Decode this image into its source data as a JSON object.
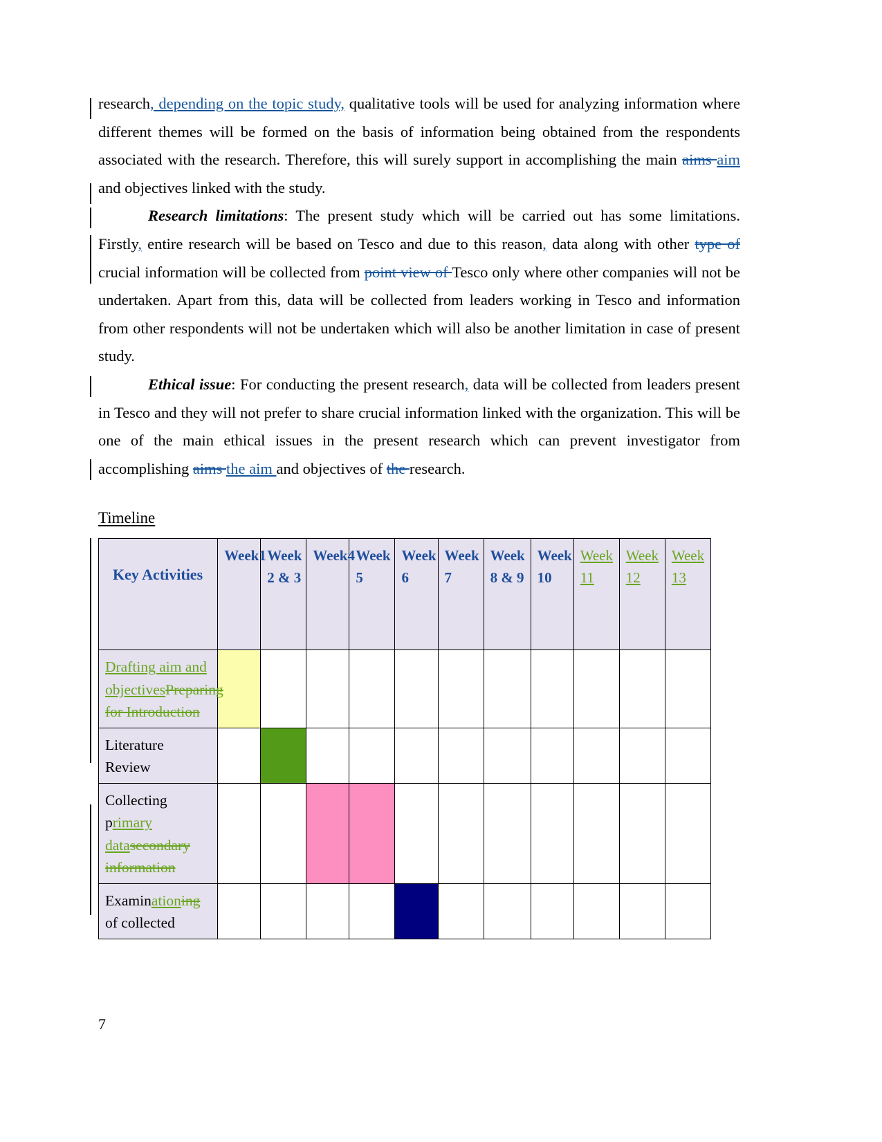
{
  "document": {
    "page_number": "7",
    "colors": {
      "insert_blue": "#16569e",
      "insert_green": "#6aa520",
      "header_blue": "#1f4e9c",
      "header_bg": "#e5e1ef",
      "fill_yellow": "#fdfdae",
      "fill_green": "#549a19",
      "fill_pink": "#fd8fc0",
      "fill_navy": "#00007f"
    }
  },
  "paragraphs": {
    "p1": {
      "r1": "research",
      "r2_ins": ", depending on the topic study,",
      "r3": " qualitative tools will be used for analyzing information where different themes will be formed on the basis of information being obtained from the respondents associated with the research. Therefore, this will surely support in accomplishing the main ",
      "r4_del": "aims ",
      "r5_ins": "aim ",
      "r6": "and objectives linked with the study."
    },
    "p2": {
      "label": "Research limitations",
      "r1": ": The present study which will be carried out has some limitations. Firstly",
      "r2_ins": ",",
      "r3": " entire research will be based on Tesco and due to this reason",
      "r4_ins": ",",
      "r5": " data along with other ",
      "r6_del": "type of ",
      "r7": "crucial information will be collected from ",
      "r8_del": "point view of ",
      "r9": "Tesco only where other companies will not be undertaken. Apart from this, data will be collected from leaders working in Tesco and information from other respondents will not be undertaken which will also be another limitation in case of present study."
    },
    "p3": {
      "label": "Ethical issue",
      "r1": ": For conducting the present research",
      "r2_ins": ",",
      "r3": " data will be collected from leaders present in Tesco and they will not prefer to share crucial information linked with the organization. This will be one of the main ethical issues in the present research which can prevent investigator from accomplishing ",
      "r4_del": "aims ",
      "r5_ins": "the aim ",
      "r6": "and objectives of ",
      "r7_del": "the ",
      "r8": "research."
    }
  },
  "timeline": {
    "heading": "Timeline",
    "headers": [
      {
        "label": "Key Activities",
        "state": "normal",
        "kind": "key"
      },
      {
        "label": "Week1",
        "state": "normal",
        "kind": "week"
      },
      {
        "label": "Week 2 & 3",
        "state": "normal",
        "kind": "week"
      },
      {
        "label": "Week4",
        "state": "normal",
        "kind": "week"
      },
      {
        "label": "Week 5",
        "state": "normal",
        "kind": "week"
      },
      {
        "label": "Week 6",
        "state": "normal",
        "kind": "week"
      },
      {
        "label": "Week 7",
        "state": "normal",
        "kind": "week"
      },
      {
        "label": "Week 8 & 9",
        "state": "normal",
        "kind": "week"
      },
      {
        "label": "Week 10",
        "state": "normal",
        "kind": "week"
      },
      {
        "label": "Week 11",
        "state": "inserted",
        "kind": "week"
      },
      {
        "label": "Week 12",
        "state": "inserted",
        "kind": "week"
      },
      {
        "label": "Week 13",
        "state": "inserted",
        "kind": "week"
      }
    ],
    "rows": [
      {
        "activity_runs": [
          {
            "text": "Drafting aim and objectives",
            "state": "inserted"
          },
          {
            "text": "Preparing for Introduction ",
            "state": "deleted"
          }
        ],
        "fills": [
          "yellow",
          "",
          "",
          "",
          "",
          "",
          "",
          "",
          "",
          "",
          ""
        ]
      },
      {
        "activity_runs": [
          {
            "text": "Literature Review",
            "state": "normal"
          }
        ],
        "fills": [
          "",
          "green",
          "",
          "",
          "",
          "",
          "",
          "",
          "",
          "",
          ""
        ]
      },
      {
        "activity_runs": [
          {
            "text": "Collecting p",
            "state": "normal"
          },
          {
            "text": "rimary data",
            "state": "inserted"
          },
          {
            "text": "secondary information",
            "state": "deleted"
          }
        ],
        "fills": [
          "",
          "",
          "pink",
          "pink",
          "",
          "",
          "",
          "",
          "",
          "",
          ""
        ]
      },
      {
        "activity_runs": [
          {
            "text": "Examin",
            "state": "normal"
          },
          {
            "text": "ation",
            "state": "inserted"
          },
          {
            "text": "ing",
            "state": "deleted"
          },
          {
            "text": " of collected",
            "state": "normal"
          }
        ],
        "fills": [
          "",
          "",
          "",
          "",
          "navy",
          "",
          "",
          "",
          "",
          "",
          ""
        ]
      }
    ]
  }
}
